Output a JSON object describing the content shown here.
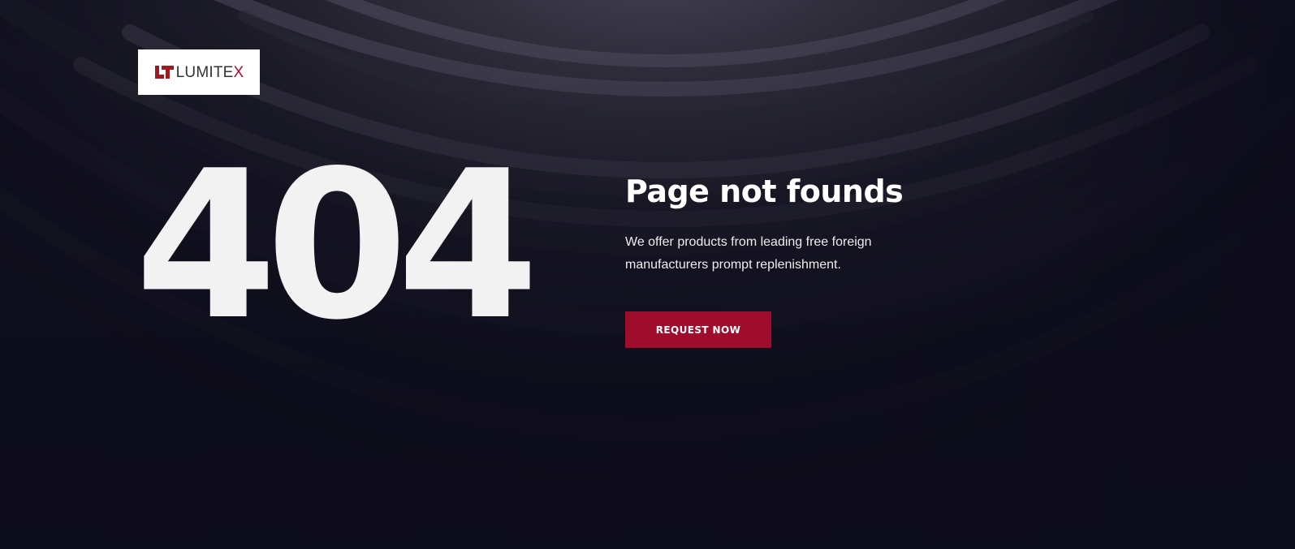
{
  "brand": {
    "logo_text_main": "LUMITE",
    "logo_text_accent": "X",
    "accent_color": "#a00c2c"
  },
  "error": {
    "code": "404",
    "title": "Page not founds",
    "description": "We offer products from leading free foreign manufacturers prompt replenishment."
  },
  "actions": {
    "request_label": "REQUEST NOW"
  },
  "icons": {
    "logo_mark": "lumitex-logo-mark"
  }
}
